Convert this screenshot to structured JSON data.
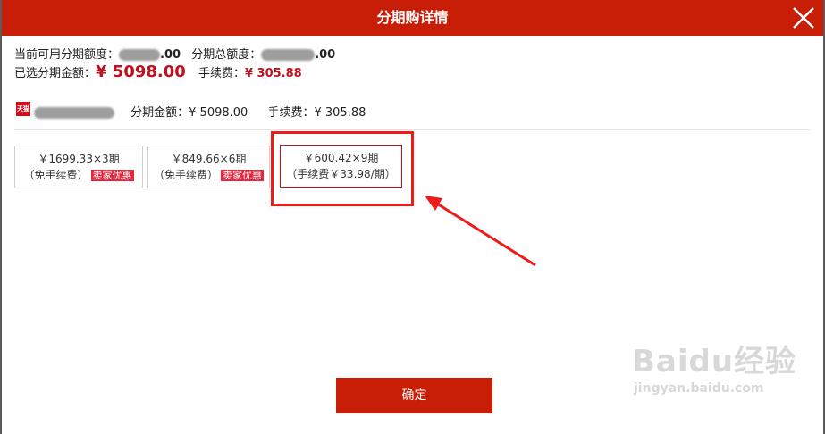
{
  "dialog": {
    "title": "分期购详情"
  },
  "summary": {
    "available_label": "当前可用分期额度：",
    "available_suffix": ".00",
    "total_label": "分期总额度：",
    "total_suffix": ".00",
    "selected_label": "已选分期金额：",
    "selected_amount": "¥ 5098.00",
    "fee_label": "手续费：",
    "fee_amount": "¥ 305.88"
  },
  "shop": {
    "logo_text": "天猫",
    "amount_label": "分期金额：",
    "amount": "¥ 5098.00",
    "fee_label": "手续费：",
    "fee": "¥ 305.88"
  },
  "options": [
    {
      "line1": "￥1699.33×3期",
      "line2": "（免手续费）",
      "tag": "卖家优惠"
    },
    {
      "line1": "￥849.66×6期",
      "line2": "（免手续费）",
      "tag": "卖家优惠"
    },
    {
      "line1": "￥600.42×9期",
      "line2": "（手续费￥33.98/期）"
    }
  ],
  "confirm_label": "确定",
  "watermark": {
    "brand": "Baidu经验",
    "url": "jingyan.baidu.com"
  },
  "colors": {
    "accent": "#c81d06",
    "price": "#c0101e",
    "annotation": "#ee1b17"
  }
}
